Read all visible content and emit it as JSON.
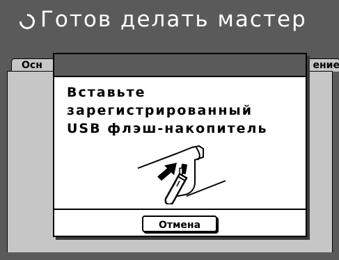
{
  "header": {
    "status_icon": "circle-arc-icon",
    "status_text": "Готов делать мастер"
  },
  "tabs": {
    "left_label": "Осн",
    "right_label": "ение"
  },
  "dialog": {
    "message": "Вставьте\nзарегистрированный\nUSB флэш-накопитель",
    "illustration_icon": "usb-insert-icon",
    "cancel_label": "Отмена"
  },
  "colors": {
    "header_bg": "#5a5a5a",
    "panel_bg": "#c6c6c6",
    "dialog_bg": "#ffffff",
    "text": "#000000"
  }
}
